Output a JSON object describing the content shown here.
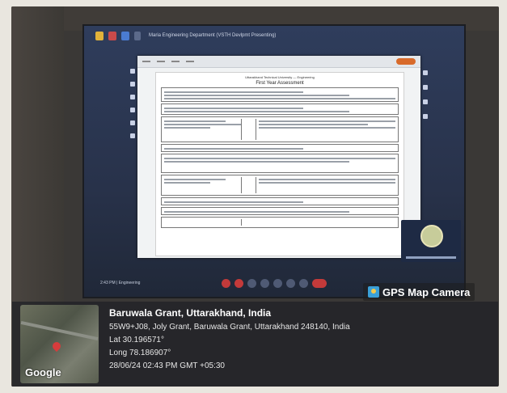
{
  "meeting": {
    "title": "Maria Engineering Department (VSTH Devlpmt Presenting)",
    "time_label": "2:43 PM | Engineering"
  },
  "document": {
    "header_line": "Uttarakhand Technical University — Engineering",
    "page_title": "First Year Assessment"
  },
  "badge": {
    "label": "GPS Map Camera"
  },
  "location": {
    "title": "Baruwala Grant, Uttarakhand, India",
    "address": "55W9+J08, Joly Grant, Baruwala Grant, Uttarakhand 248140, India",
    "lat": "Lat 30.196571°",
    "long": "Long 78.186907°",
    "timestamp": "28/06/24 02:43 PM GMT +05:30"
  },
  "map": {
    "provider": "Google"
  },
  "colors": {
    "gps_icon": "#3aa0d8",
    "end_call": "#c33a3a",
    "share": "#d86a2a"
  }
}
